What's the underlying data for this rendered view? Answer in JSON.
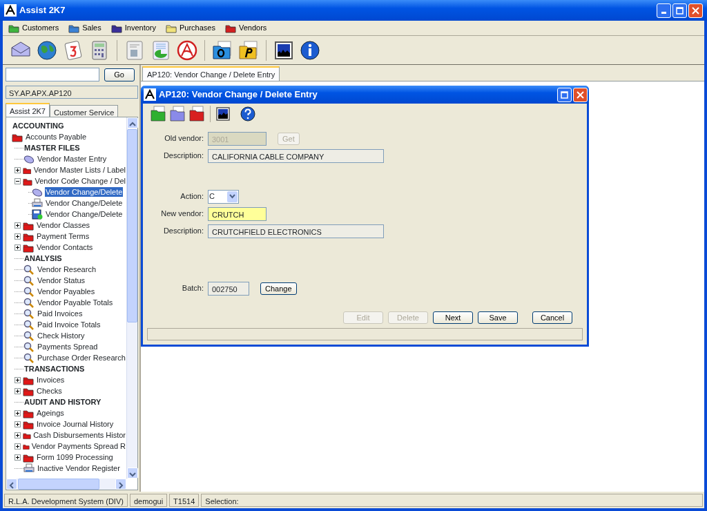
{
  "window": {
    "title": "Assist 2K7"
  },
  "menu": [
    {
      "label": "Customers",
      "color": "#3fb53f"
    },
    {
      "label": "Sales",
      "color": "#3b82d6"
    },
    {
      "label": "Inventory",
      "color": "#3a2f9a"
    },
    {
      "label": "Purchases",
      "color": "#f0e27a"
    },
    {
      "label": "Vendors",
      "color": "#d42020"
    }
  ],
  "sidebar": {
    "go_button": "Go",
    "path": "SY.AP.APX.AP120",
    "tabs": [
      {
        "label": "Assist 2K7",
        "selected": true
      },
      {
        "label": "Customer Service",
        "selected": false
      }
    ],
    "tree": [
      {
        "kind": "section",
        "label": "ACCOUNTING",
        "selected": false
      },
      {
        "kind": "folder",
        "label": "Accounts Payable",
        "selected": false,
        "children": [
          {
            "kind": "heading",
            "label": "MASTER FILES",
            "selected": false
          },
          {
            "kind": "entry",
            "label": "Vendor Master Entry",
            "selected": false
          },
          {
            "kind": "folder",
            "label": "Vendor Master Lists / Label",
            "selected": false,
            "expanded": false
          },
          {
            "kind": "folder",
            "label": "Vendor Code Change / Del",
            "selected": false,
            "expanded": true,
            "children": [
              {
                "kind": "entry",
                "label": "Vendor Change/Delete",
                "selected": true
              },
              {
                "kind": "report",
                "label": "Vendor Change/Delete",
                "selected": false
              },
              {
                "kind": "export",
                "label": "Vendor Change/Delete",
                "selected": false
              }
            ]
          },
          {
            "kind": "folder",
            "label": "Vendor Classes",
            "selected": false,
            "expanded": false
          },
          {
            "kind": "folder",
            "label": "Payment Terms",
            "selected": false,
            "expanded": false
          },
          {
            "kind": "folder",
            "label": "Vendor Contacts",
            "selected": false,
            "expanded": false
          },
          {
            "kind": "heading",
            "label": "ANALYSIS",
            "selected": false
          },
          {
            "kind": "search",
            "label": "Vendor Research",
            "selected": false
          },
          {
            "kind": "search",
            "label": "Vendor Status",
            "selected": false
          },
          {
            "kind": "search",
            "label": "Vendor Payables",
            "selected": false
          },
          {
            "kind": "search",
            "label": "Vendor Payable Totals",
            "selected": false
          },
          {
            "kind": "search",
            "label": "Paid Invoices",
            "selected": false
          },
          {
            "kind": "search",
            "label": "Paid Invoice Totals",
            "selected": false
          },
          {
            "kind": "search",
            "label": "Check History",
            "selected": false
          },
          {
            "kind": "search",
            "label": "Payments Spread",
            "selected": false
          },
          {
            "kind": "search",
            "label": "Purchase Order Research",
            "selected": false
          },
          {
            "kind": "heading",
            "label": "TRANSACTIONS",
            "selected": false
          },
          {
            "kind": "folder",
            "label": "Invoices",
            "selected": false,
            "expanded": false
          },
          {
            "kind": "folder",
            "label": "Checks",
            "selected": false,
            "expanded": false
          },
          {
            "kind": "heading",
            "label": "AUDIT AND HISTORY",
            "selected": false
          },
          {
            "kind": "folder",
            "label": "Ageings",
            "selected": false,
            "expanded": false
          },
          {
            "kind": "folder",
            "label": "Invoice Journal History",
            "selected": false,
            "expanded": false
          },
          {
            "kind": "folder",
            "label": "Cash Disbursements Histor",
            "selected": false,
            "expanded": false
          },
          {
            "kind": "folder",
            "label": "Vendor Payments Spread R",
            "selected": false,
            "expanded": false
          },
          {
            "kind": "folder",
            "label": "Form 1099 Processing",
            "selected": false,
            "expanded": false
          },
          {
            "kind": "report",
            "label": "Inactive Vendor Register",
            "selected": false
          }
        ]
      }
    ]
  },
  "document_tabs": [
    {
      "label": "AP120: Vendor Change / Delete Entry",
      "selected": true
    }
  ],
  "dialog": {
    "title": "AP120: Vendor Change / Delete Entry",
    "groups": [
      [
        {
          "kind": "code",
          "label": "Old vendor:",
          "value": "3001",
          "disabled": true,
          "focused": false,
          "button": {
            "label": "Get",
            "disabled": true
          }
        },
        {
          "kind": "description",
          "label": "Description:",
          "value": "CALIFORNIA CABLE COMPANY",
          "disabled": false,
          "focused": false
        }
      ],
      [
        {
          "kind": "select",
          "label": "Action:",
          "value": "C",
          "disabled": false,
          "focused": false
        },
        {
          "kind": "code",
          "label": "New vendor:",
          "value": "CRUTCH",
          "disabled": false,
          "focused": true
        },
        {
          "kind": "description",
          "label": "Description:",
          "value": "CRUTCHFIELD ELECTRONICS",
          "disabled": false,
          "focused": false
        }
      ],
      [
        {
          "kind": "number",
          "label": "Batch:",
          "value": "002750",
          "disabled": false,
          "focused": false,
          "button": {
            "label": "Change",
            "disabled": false
          }
        }
      ]
    ],
    "buttons": [
      {
        "label": "Edit",
        "disabled": true
      },
      {
        "label": "Delete",
        "disabled": true
      },
      {
        "label": "Next",
        "disabled": false
      },
      {
        "label": "Save",
        "disabled": false
      },
      {
        "label": "Cancel",
        "disabled": false
      }
    ]
  },
  "status_bar": [
    "R.L.A. Development System (DIV)",
    "demogui",
    "T1514",
    "Selection:"
  ]
}
